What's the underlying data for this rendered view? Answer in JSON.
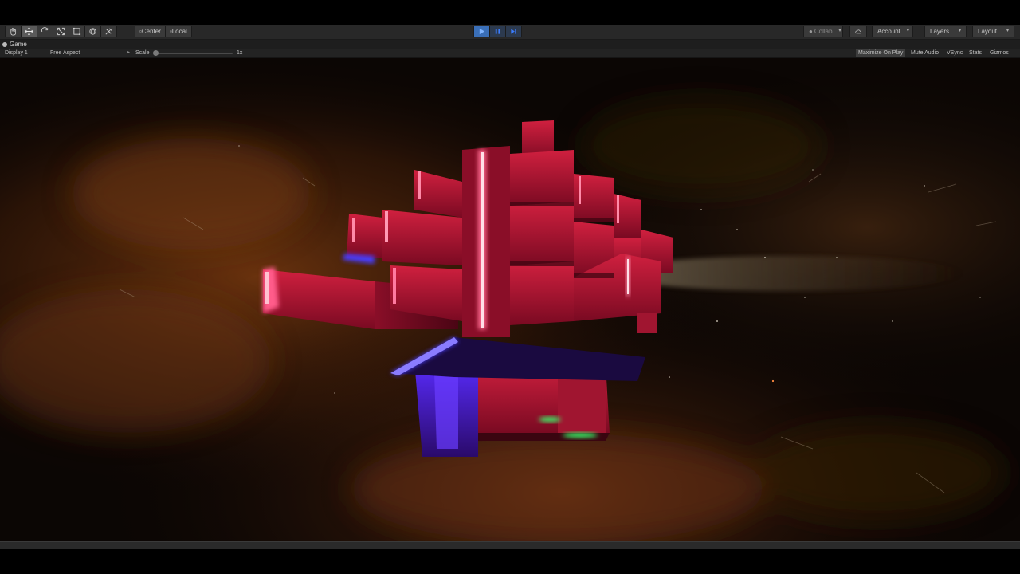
{
  "toolbar": {
    "tools": [
      {
        "name": "hand-tool",
        "active": false
      },
      {
        "name": "move-tool",
        "active": true
      },
      {
        "name": "rotate-tool",
        "active": false
      },
      {
        "name": "scale-tool",
        "active": false
      },
      {
        "name": "rect-tool",
        "active": false
      },
      {
        "name": "transform-tool",
        "active": false
      },
      {
        "name": "custom-tool",
        "active": false
      }
    ],
    "pivot_mode": "Center",
    "pivot_rotation": "Local",
    "play_state": "playing",
    "collab_label": "Collab",
    "account_label": "Account",
    "layers_label": "Layers",
    "layout_label": "Layout"
  },
  "tab": {
    "title": "Game"
  },
  "game_view": {
    "display": "Display 1",
    "aspect": "Free Aspect",
    "scale_label": "Scale",
    "scale_value": "1x",
    "toggles": [
      {
        "label": "Maximize On Play",
        "on": true
      },
      {
        "label": "Mute Audio",
        "on": false
      },
      {
        "label": "VSync",
        "on": false
      },
      {
        "label": "Stats",
        "on": false
      },
      {
        "label": "Gizmos",
        "on": false
      }
    ]
  },
  "colors": {
    "toolbar_bg": "#282828",
    "play_accent": "#3a6fb8",
    "ship_red": "#c01838",
    "glow_pink": "#ff5c8a",
    "glow_blue": "#4a3cff",
    "glow_green": "#39ff6a",
    "nebula_orange": "#7a3a10"
  }
}
